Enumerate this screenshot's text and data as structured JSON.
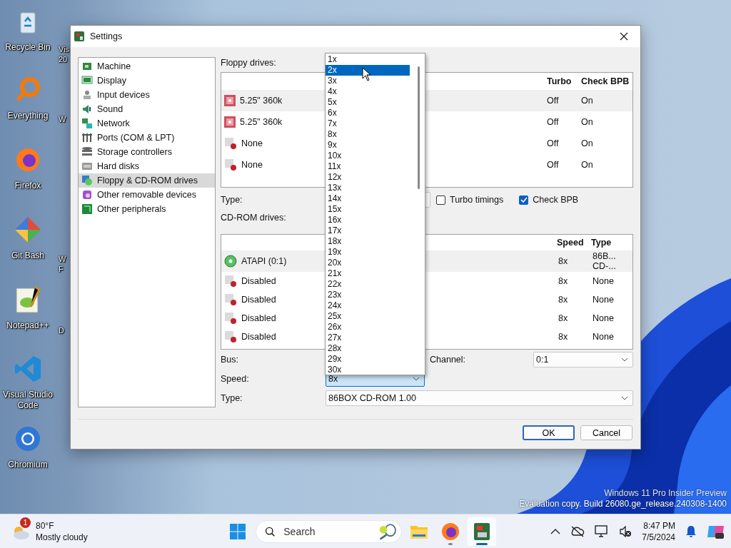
{
  "desktop_icons": [
    {
      "label": "Recycle Bin"
    },
    {
      "label": "Everything"
    },
    {
      "label": "Firefox"
    },
    {
      "label": "Git Bash"
    },
    {
      "label": "Notepad++"
    },
    {
      "label": "Visual Studio Code"
    },
    {
      "label": "Chromium"
    }
  ],
  "desktop_icons_column_2": [
    {
      "lines": [
        "Vis",
        "20"
      ]
    },
    {
      "lines": [
        "W"
      ]
    },
    {
      "lines": [
        "W",
        "F"
      ]
    },
    {
      "lines": [
        "D"
      ]
    }
  ],
  "os_build_notice": [
    "Windows 11 Pro Insider Preview",
    "Evaluation copy. Build 26080.ge_release.240308-1400"
  ],
  "dialog": {
    "title": "Settings",
    "sidebar": {
      "items": [
        {
          "label": "Machine",
          "selected": false
        },
        {
          "label": "Display",
          "selected": false
        },
        {
          "label": "Input devices",
          "selected": false
        },
        {
          "label": "Sound",
          "selected": false
        },
        {
          "label": "Network",
          "selected": false
        },
        {
          "label": "Ports (COM & LPT)",
          "selected": false
        },
        {
          "label": "Storage controllers",
          "selected": false
        },
        {
          "label": "Hard disks",
          "selected": false
        },
        {
          "label": "Floppy & CD-ROM drives",
          "selected": true
        },
        {
          "label": "Other removable devices",
          "selected": false
        },
        {
          "label": "Other peripherals",
          "selected": false
        }
      ]
    },
    "floppy": {
      "label": "Floppy drives:",
      "columns": [
        "Turbo",
        "Check BPB"
      ],
      "rows": [
        {
          "kind": "floppy",
          "name": "5.25\" 360k",
          "turbo": "Off",
          "check_bpb": "On",
          "selected": true
        },
        {
          "kind": "floppy",
          "name": "5.25\" 360k",
          "turbo": "Off",
          "check_bpb": "On",
          "selected": false
        },
        {
          "kind": "empty",
          "name": "None",
          "turbo": "Off",
          "check_bpb": "On",
          "selected": false
        },
        {
          "kind": "empty",
          "name": "None",
          "turbo": "Off",
          "check_bpb": "On",
          "selected": false
        }
      ],
      "type_label": "Type:",
      "turbo_timings": {
        "label": "Turbo timings",
        "checked": false
      },
      "check_bpb": {
        "label": "Check BPB",
        "checked": true
      }
    },
    "cdrom": {
      "label": "CD-ROM drives:",
      "columns": [
        "Speed",
        "Type"
      ],
      "rows": [
        {
          "kind": "cdrom",
          "name": "ATAPI (0:1)",
          "speed": "8x",
          "type": "86B... CD-...",
          "selected": true
        },
        {
          "kind": "empty",
          "name": "Disabled",
          "speed": "8x",
          "type": "None",
          "selected": false
        },
        {
          "kind": "empty",
          "name": "Disabled",
          "speed": "8x",
          "type": "None",
          "selected": false
        },
        {
          "kind": "empty",
          "name": "Disabled",
          "speed": "8x",
          "type": "None",
          "selected": false
        },
        {
          "kind": "empty",
          "name": "Disabled",
          "speed": "8x",
          "type": "None",
          "selected": false
        }
      ],
      "bus_label": "Bus:",
      "speed_label": "Speed:",
      "speed_value": "8x",
      "channel_label": "Channel:",
      "channel_value": "0:1",
      "type_label": "Type:",
      "type_value": "86BOX CD-ROM 1.00"
    },
    "speed_dropdown": {
      "items": [
        {
          "label": "1x",
          "selected": false
        },
        {
          "label": "2x",
          "selected": true
        },
        {
          "label": "3x",
          "selected": false
        },
        {
          "label": "4x",
          "selected": false
        },
        {
          "label": "5x",
          "selected": false
        },
        {
          "label": "6x",
          "selected": false
        },
        {
          "label": "7x",
          "selected": false
        },
        {
          "label": "8x",
          "selected": false
        },
        {
          "label": "9x",
          "selected": false
        },
        {
          "label": "10x",
          "selected": false
        },
        {
          "label": "11x",
          "selected": false
        },
        {
          "label": "12x",
          "selected": false
        },
        {
          "label": "13x",
          "selected": false
        },
        {
          "label": "14x",
          "selected": false
        },
        {
          "label": "15x",
          "selected": false
        },
        {
          "label": "16x",
          "selected": false
        },
        {
          "label": "17x",
          "selected": false
        },
        {
          "label": "18x",
          "selected": false
        },
        {
          "label": "19x",
          "selected": false
        },
        {
          "label": "20x",
          "selected": false
        },
        {
          "label": "21x",
          "selected": false
        },
        {
          "label": "22x",
          "selected": false
        },
        {
          "label": "23x",
          "selected": false
        },
        {
          "label": "24x",
          "selected": false
        },
        {
          "label": "25x",
          "selected": false
        },
        {
          "label": "26x",
          "selected": false
        },
        {
          "label": "27x",
          "selected": false
        },
        {
          "label": "28x",
          "selected": false
        },
        {
          "label": "29x",
          "selected": false
        },
        {
          "label": "30x",
          "selected": false
        }
      ]
    },
    "buttons": [
      {
        "label": "OK",
        "default": true
      },
      {
        "label": "Cancel",
        "default": false
      }
    ]
  },
  "taskbar": {
    "weather": {
      "badge": "1",
      "temperature": "80°F",
      "condition": "Mostly cloudy"
    },
    "search": {
      "placeholder": "Search"
    },
    "apps": [
      {
        "running": false,
        "active": false
      },
      {
        "running": true,
        "active": false
      },
      {
        "running": true,
        "active": true
      }
    ],
    "clock": {
      "time": "8:47 PM",
      "date": "7/5/2024"
    }
  }
}
